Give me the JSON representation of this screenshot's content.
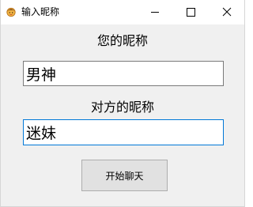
{
  "window": {
    "title": "输入昵称",
    "icon": "app-face-icon",
    "controls": {
      "minimize_icon": "minimize-icon",
      "maximize_icon": "maximize-icon",
      "close_icon": "close-icon"
    }
  },
  "form": {
    "nickname_label": "您的昵称",
    "nickname_value": "男神",
    "other_label": "对方的昵称",
    "other_value": "迷妹",
    "start_button_label": "开始聊天"
  },
  "colors": {
    "window_bg": "#f0f0f0",
    "titlebar_bg": "#ffffff",
    "focus_border": "#0078d7",
    "input_border": "#7a7a7a",
    "button_bg": "#e1e1e1",
    "button_border": "#adadad"
  }
}
